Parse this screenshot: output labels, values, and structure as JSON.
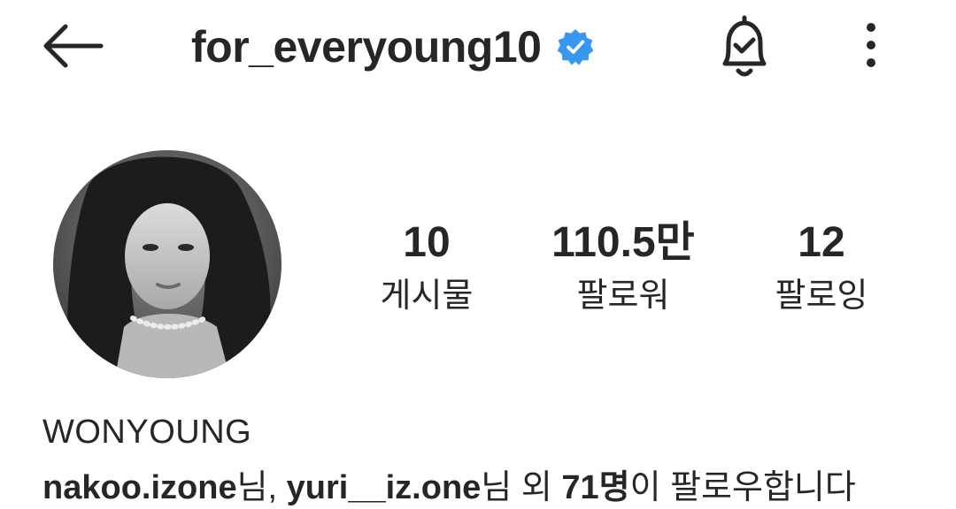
{
  "header": {
    "username": "for_everyoung10",
    "verified": true,
    "back_icon": "arrow-left-icon",
    "bell_icon": "bell-check-icon",
    "more_icon": "vertical-dots-icon",
    "verified_color": "#3897f0"
  },
  "profile": {
    "avatar": "profile-photo",
    "display_name": "WONYOUNG"
  },
  "stats": [
    {
      "value": "10",
      "label": "게시물"
    },
    {
      "value": "110.5만",
      "label": "팔로워"
    },
    {
      "value": "12",
      "label": "팔로잉"
    }
  ],
  "followed_by": {
    "user1": "nakoo.izone",
    "suffix1": "님, ",
    "user2": "yuri__iz.one",
    "suffix2": "님 외 ",
    "count": "71명",
    "suffix3": "이 팔로우합니다"
  }
}
